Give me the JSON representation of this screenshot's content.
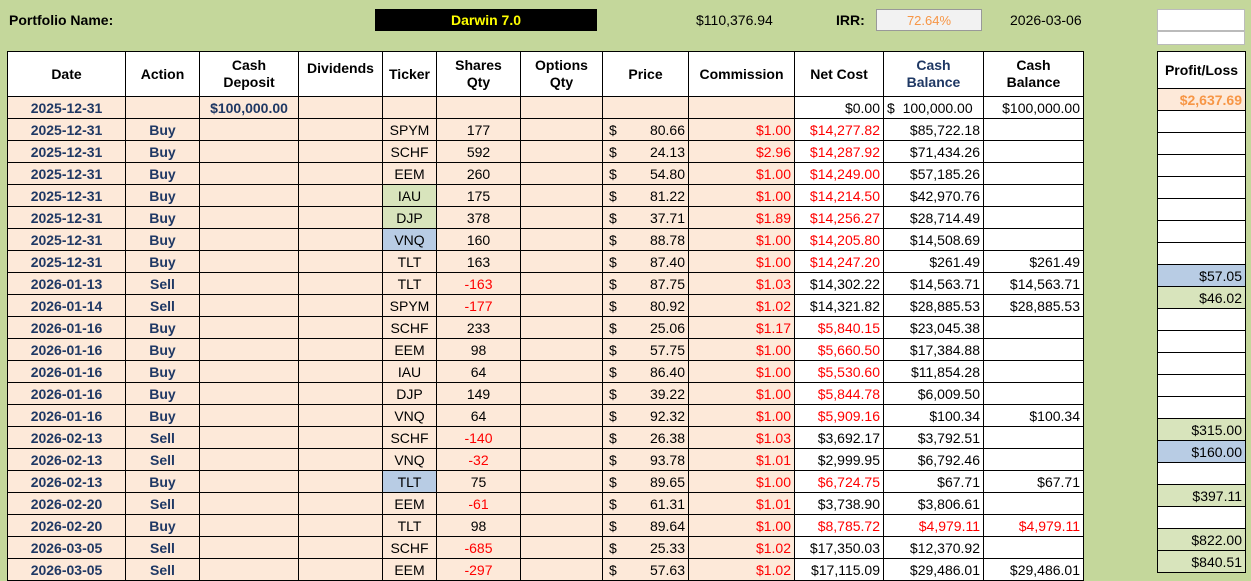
{
  "header": {
    "portfolio_label": "Portfolio Name:",
    "portfolio_name": "Darwin 7.0",
    "total_value": "$110,376.94",
    "irr_label": "IRR:",
    "irr_value": "72.64%",
    "date": "2026-03-06"
  },
  "columns": {
    "date": "Date",
    "action": "Action",
    "cash_deposit_1": "Cash",
    "cash_deposit_2": "Deposit",
    "dividends": "Dividends",
    "ticker": "Ticker",
    "shares_1": "Shares",
    "shares_2": "Qty",
    "options_1": "Options",
    "options_2": "Qty",
    "price": "Price",
    "commission": "Commission",
    "net_cost": "Net Cost",
    "cash_bal_1": "Cash",
    "cash_bal_2": "Balance",
    "cash_bal2_1": "Cash",
    "cash_bal2_2": "Balance",
    "profit_loss": "Profit/Loss"
  },
  "rows": [
    {
      "date": "2025-12-31",
      "action": "",
      "deposit": "$100,000.00",
      "ticker": "",
      "qty": "",
      "price": "",
      "commission": "",
      "net_cost": "$0.00",
      "cash_balance": "$  100,000.00",
      "cash_balance2": "$100,000.00",
      "pl": "$2,637.69"
    },
    {
      "date": "2025-12-31",
      "action": "Buy",
      "deposit": "",
      "ticker": "SPYM",
      "qty": "177",
      "price": "80.66",
      "commission": "$1.00",
      "net_cost": "$14,277.82",
      "cash_balance": "$85,722.18",
      "cash_balance2": "",
      "pl": ""
    },
    {
      "date": "2025-12-31",
      "action": "Buy",
      "deposit": "",
      "ticker": "SCHF",
      "qty": "592",
      "price": "24.13",
      "commission": "$2.96",
      "net_cost": "$14,287.92",
      "cash_balance": "$71,434.26",
      "cash_balance2": "",
      "pl": ""
    },
    {
      "date": "2025-12-31",
      "action": "Buy",
      "deposit": "",
      "ticker": "EEM",
      "qty": "260",
      "price": "54.80",
      "commission": "$1.00",
      "net_cost": "$14,249.00",
      "cash_balance": "$57,185.26",
      "cash_balance2": "",
      "pl": ""
    },
    {
      "date": "2025-12-31",
      "action": "Buy",
      "deposit": "",
      "ticker": "IAU",
      "qty": "175",
      "price": "81.22",
      "commission": "$1.00",
      "net_cost": "$14,214.50",
      "cash_balance": "$42,970.76",
      "cash_balance2": "",
      "pl": ""
    },
    {
      "date": "2025-12-31",
      "action": "Buy",
      "deposit": "",
      "ticker": "DJP",
      "qty": "378",
      "price": "37.71",
      "commission": "$1.89",
      "net_cost": "$14,256.27",
      "cash_balance": "$28,714.49",
      "cash_balance2": "",
      "pl": ""
    },
    {
      "date": "2025-12-31",
      "action": "Buy",
      "deposit": "",
      "ticker": "VNQ",
      "qty": "160",
      "price": "88.78",
      "commission": "$1.00",
      "net_cost": "$14,205.80",
      "cash_balance": "$14,508.69",
      "cash_balance2": "",
      "pl": ""
    },
    {
      "date": "2025-12-31",
      "action": "Buy",
      "deposit": "",
      "ticker": "TLT",
      "qty": "163",
      "price": "87.40",
      "commission": "$1.00",
      "net_cost": "$14,247.20",
      "cash_balance": "$261.49",
      "cash_balance2": "$261.49",
      "pl": ""
    },
    {
      "date": "2026-01-13",
      "action": "Sell",
      "deposit": "",
      "ticker": "TLT",
      "qty": "-163",
      "price": "87.75",
      "commission": "$1.03",
      "net_cost": "$14,302.22",
      "cash_balance": "$14,563.71",
      "cash_balance2": "$14,563.71",
      "pl": "$57.05"
    },
    {
      "date": "2026-01-14",
      "action": "Sell",
      "deposit": "",
      "ticker": "SPYM",
      "qty": "-177",
      "price": "80.92",
      "commission": "$1.02",
      "net_cost": "$14,321.82",
      "cash_balance": "$28,885.53",
      "cash_balance2": "$28,885.53",
      "pl": "$46.02"
    },
    {
      "date": "2026-01-16",
      "action": "Buy",
      "deposit": "",
      "ticker": "SCHF",
      "qty": "233",
      "price": "25.06",
      "commission": "$1.17",
      "net_cost": "$5,840.15",
      "cash_balance": "$23,045.38",
      "cash_balance2": "",
      "pl": ""
    },
    {
      "date": "2026-01-16",
      "action": "Buy",
      "deposit": "",
      "ticker": "EEM",
      "qty": "98",
      "price": "57.75",
      "commission": "$1.00",
      "net_cost": "$5,660.50",
      "cash_balance": "$17,384.88",
      "cash_balance2": "",
      "pl": ""
    },
    {
      "date": "2026-01-16",
      "action": "Buy",
      "deposit": "",
      "ticker": "IAU",
      "qty": "64",
      "price": "86.40",
      "commission": "$1.00",
      "net_cost": "$5,530.60",
      "cash_balance": "$11,854.28",
      "cash_balance2": "",
      "pl": ""
    },
    {
      "date": "2026-01-16",
      "action": "Buy",
      "deposit": "",
      "ticker": "DJP",
      "qty": "149",
      "price": "39.22",
      "commission": "$1.00",
      "net_cost": "$5,844.78",
      "cash_balance": "$6,009.50",
      "cash_balance2": "",
      "pl": ""
    },
    {
      "date": "2026-01-16",
      "action": "Buy",
      "deposit": "",
      "ticker": "VNQ",
      "qty": "64",
      "price": "92.32",
      "commission": "$1.00",
      "net_cost": "$5,909.16",
      "cash_balance": "$100.34",
      "cash_balance2": "$100.34",
      "pl": ""
    },
    {
      "date": "2026-02-13",
      "action": "Sell",
      "deposit": "",
      "ticker": "SCHF",
      "qty": "-140",
      "price": "26.38",
      "commission": "$1.03",
      "net_cost": "$3,692.17",
      "cash_balance": "$3,792.51",
      "cash_balance2": "",
      "pl": "$315.00"
    },
    {
      "date": "2026-02-13",
      "action": "Sell",
      "deposit": "",
      "ticker": "VNQ",
      "qty": "-32",
      "price": "93.78",
      "commission": "$1.01",
      "net_cost": "$2,999.95",
      "cash_balance": "$6,792.46",
      "cash_balance2": "",
      "pl": "$160.00"
    },
    {
      "date": "2026-02-13",
      "action": "Buy",
      "deposit": "",
      "ticker": "TLT",
      "qty": "75",
      "price": "89.65",
      "commission": "$1.00",
      "net_cost": "$6,724.75",
      "cash_balance": "$67.71",
      "cash_balance2": "$67.71",
      "pl": ""
    },
    {
      "date": "2026-02-20",
      "action": "Sell",
      "deposit": "",
      "ticker": "EEM",
      "qty": "-61",
      "price": "61.31",
      "commission": "$1.01",
      "net_cost": "$3,738.90",
      "cash_balance": "$3,806.61",
      "cash_balance2": "",
      "pl": "$397.11"
    },
    {
      "date": "2026-02-20",
      "action": "Buy",
      "deposit": "",
      "ticker": "TLT",
      "qty": "98",
      "price": "89.64",
      "commission": "$1.00",
      "net_cost": "$8,785.72",
      "cash_balance": "$4,979.11",
      "cash_balance2": "$4,979.11",
      "pl": ""
    },
    {
      "date": "2026-03-05",
      "action": "Sell",
      "deposit": "",
      "ticker": "SCHF",
      "qty": "-685",
      "price": "25.33",
      "commission": "$1.02",
      "net_cost": "$17,350.03",
      "cash_balance": "$12,370.92",
      "cash_balance2": "",
      "pl": "$822.00"
    },
    {
      "date": "2026-03-05",
      "action": "Sell",
      "deposit": "",
      "ticker": "EEM",
      "qty": "-297",
      "price": "57.63",
      "commission": "$1.02",
      "net_cost": "$17,115.09",
      "cash_balance": "$29,486.01",
      "cash_balance2": "$29,486.01",
      "pl": "$840.51"
    }
  ],
  "ticker_highlight": {
    "4": "green",
    "5": "green",
    "6": "blue",
    "17": "blue"
  },
  "pl_highlight": {
    "0": "orange",
    "8": "blue",
    "9": "green",
    "15": "green",
    "16": "blue",
    "18": "green",
    "20": "green",
    "21": "green"
  },
  "red_net_cost_rows": [
    1,
    2,
    3,
    4,
    5,
    6,
    7,
    10,
    11,
    12,
    13,
    14,
    17,
    19
  ],
  "red_cash_balance_rows": [
    19
  ],
  "currency_symbol": "$",
  "colors": {
    "background": "#c4d79b",
    "row_fill": "#fde9d9",
    "accent_orange": "#f79646",
    "title_yellow": "#ffff00",
    "negative_red": "#ff0000"
  }
}
